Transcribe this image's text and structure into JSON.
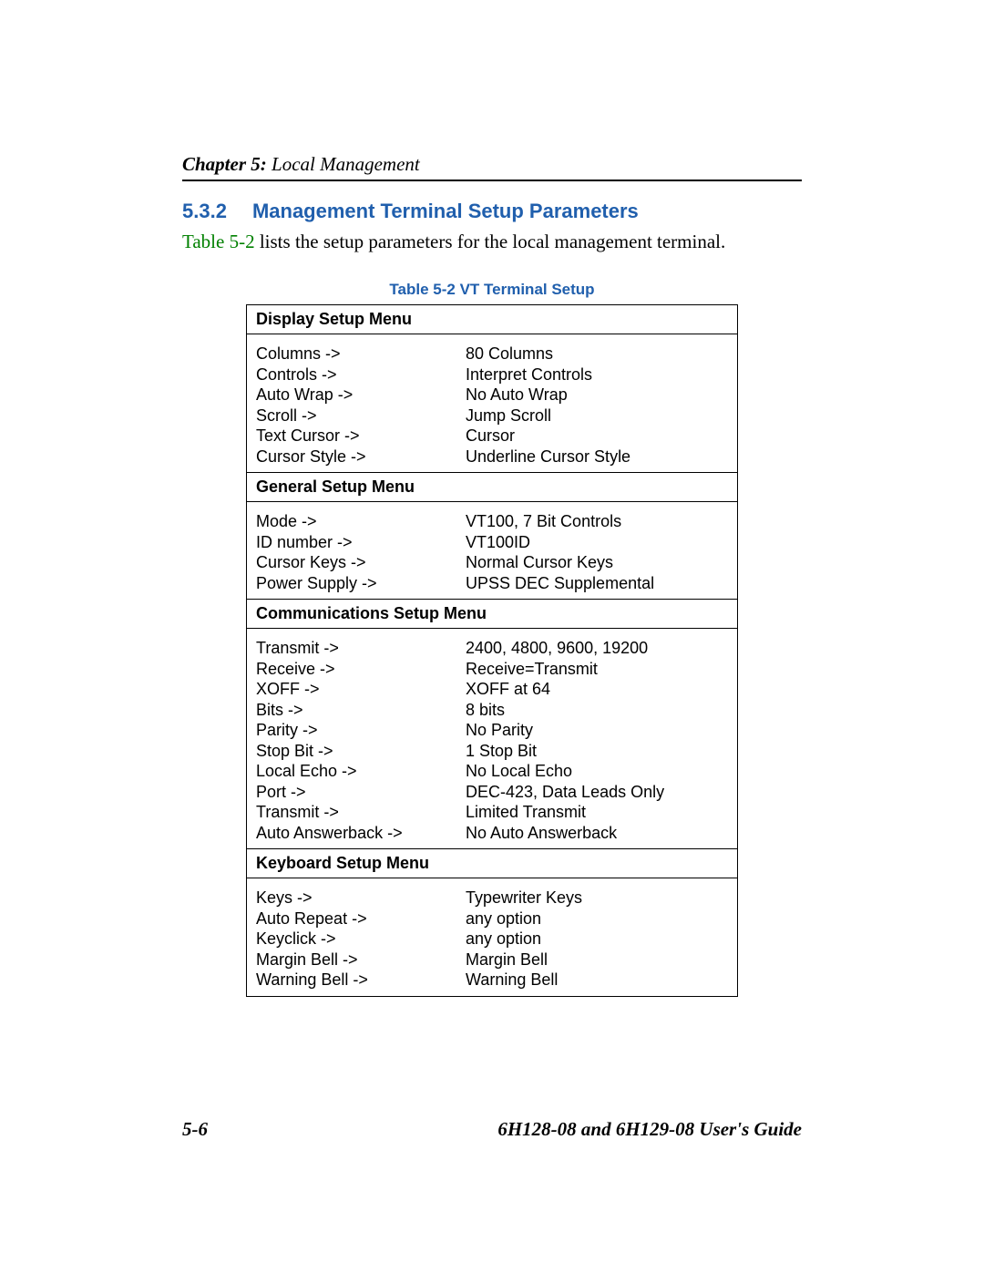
{
  "chapter": {
    "prefix": "Chapter 5:",
    "title": " Local Management"
  },
  "section": {
    "number": "5.3.2",
    "title": "Management Terminal Setup Parameters"
  },
  "intro": {
    "ref": "Table 5-2",
    "rest": " lists the setup parameters for the local management terminal."
  },
  "table": {
    "caption": "Table 5-2    VT Terminal Setup",
    "sections": [
      {
        "header": "Display Setup Menu",
        "rows": [
          {
            "label": "Columns  ->",
            "value": "80 Columns"
          },
          {
            "label": "Controls ->",
            "value": "Interpret Controls"
          },
          {
            "label": "Auto Wrap ->",
            "value": "No Auto Wrap"
          },
          {
            "label": "Scroll ->",
            "value": "Jump Scroll"
          },
          {
            "label": "Text Cursor ->",
            "value": "Cursor"
          },
          {
            "label": "Cursor Style ->",
            "value": "Underline Cursor Style"
          }
        ]
      },
      {
        "header": "General Setup Menu",
        "rows": [
          {
            "label": "Mode ->",
            "value": "VT100, 7 Bit Controls"
          },
          {
            "label": "ID number ->",
            "value": "VT100ID"
          },
          {
            "label": "Cursor Keys ->",
            "value": "Normal Cursor Keys"
          },
          {
            "label": "Power Supply ->",
            "value": "UPSS DEC Supplemental"
          }
        ]
      },
      {
        "header": "Communications Setup Menu",
        "rows": [
          {
            "label": "Transmit ->",
            "value": "2400, 4800, 9600, 19200"
          },
          {
            "label": "Receive ->",
            "value": "Receive=Transmit"
          },
          {
            "label": "XOFF ->",
            "value": "XOFF at 64"
          },
          {
            "label": "Bits  ->",
            "value": "8 bits"
          },
          {
            "label": "Parity ->",
            "value": "No Parity"
          },
          {
            "label": "Stop Bit ->",
            "value": "1 Stop Bit"
          },
          {
            "label": "Local Echo ->",
            "value": "No Local Echo"
          },
          {
            "label": "Port  ->",
            "value": "DEC-423, Data Leads Only"
          },
          {
            "label": "Transmit ->",
            "value": "Limited Transmit"
          },
          {
            "label": "Auto Answerback ->",
            "value": "No Auto Answerback"
          }
        ]
      },
      {
        "header": "Keyboard Setup Menu",
        "rows": [
          {
            "label": "Keys ->",
            "value": "Typewriter Keys"
          },
          {
            "label": "Auto Repeat ->",
            "value": "any option"
          },
          {
            "label": "Keyclick ->",
            "value": "any option"
          },
          {
            "label": "Margin Bell ->",
            "value": "Margin Bell"
          },
          {
            "label": "Warning Bell ->",
            "value": "Warning Bell"
          }
        ]
      }
    ]
  },
  "footer": {
    "left": "5-6",
    "right": "6H128-08 and 6H129-08 User's Guide"
  }
}
